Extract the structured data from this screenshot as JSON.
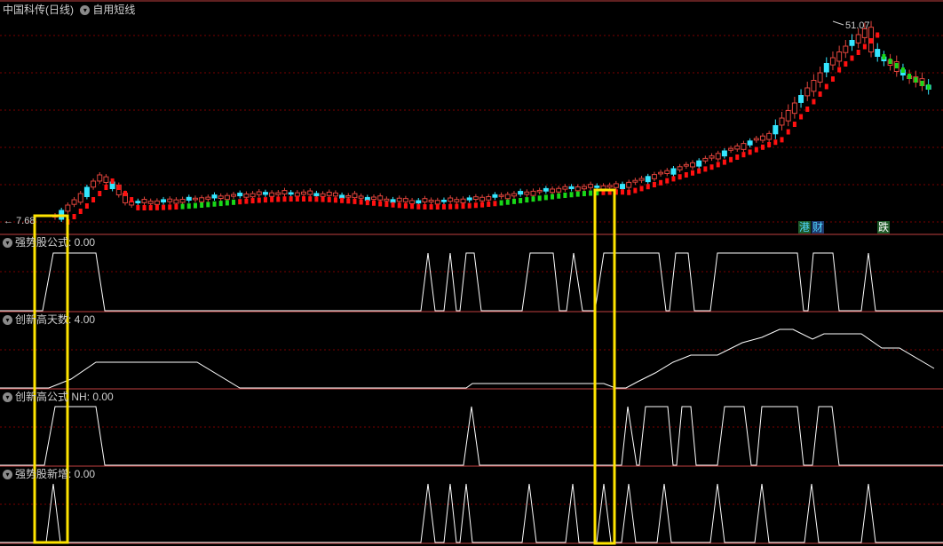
{
  "header": {
    "stock_name": "中国科传(日线)",
    "indicator_name": "自用短线"
  },
  "main_chart": {
    "high_label": "51.07",
    "low_label": "7.68",
    "tags": [
      {
        "text": "港",
        "color": "#4fd6ff",
        "bg": "#1e5a28"
      },
      {
        "text": "财",
        "color": "#4fd6ff",
        "bg": "#1e3a6e"
      },
      {
        "text": "跌",
        "color": "#ffffff",
        "bg": "#1e5a28"
      }
    ]
  },
  "panels": [
    {
      "title": "强势股公式",
      "value": ": 0.00"
    },
    {
      "title": "创新高天数",
      "value": ": 4.00"
    },
    {
      "title": "创新高公式",
      "value": "NH: 0.00"
    },
    {
      "title": "强势股新增",
      "value": ": 0.00"
    }
  ],
  "colors": {
    "grid": "#7a0000",
    "separator": "#c04040",
    "up": "#e0443c",
    "down": "#35e6ff",
    "ma_up": "#ff1010",
    "ma_down": "#18d818",
    "signal": "#ffffff",
    "highlight": "#ffe400"
  },
  "icons": {
    "panel_toggle": "chevron-down-icon"
  }
}
